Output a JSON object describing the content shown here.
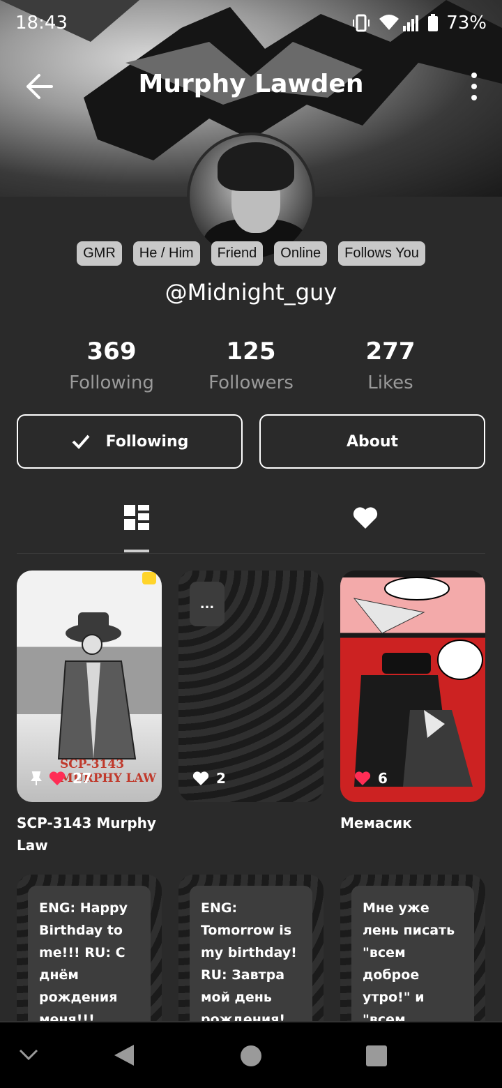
{
  "status_bar": {
    "time": "18:43",
    "battery": "73%"
  },
  "header": {
    "title": "Murphy Lawden",
    "back_icon": "arrow-left-icon",
    "more_icon": "more-vertical-icon"
  },
  "profile": {
    "tags": [
      "GMR",
      "He / Him",
      "Friend",
      "Online",
      "Follows You"
    ],
    "username": "@Midnight_guy",
    "stats": [
      {
        "value": "369",
        "label": "Following"
      },
      {
        "value": "125",
        "label": "Followers"
      },
      {
        "value": "277",
        "label": "Likes"
      }
    ],
    "buttons": {
      "following": "Following",
      "about": "About"
    }
  },
  "tabs": [
    {
      "icon": "grid-icon",
      "active": true
    },
    {
      "icon": "heart-icon",
      "active": false
    }
  ],
  "posts": [
    {
      "title": "SCP-3143 Murphy Law",
      "likes": "27",
      "pinned": true,
      "image_text": "SCP-3143 MURPHY LAW"
    },
    {
      "title": "",
      "likes": "2",
      "more_label": "..."
    },
    {
      "title": "Мемасик",
      "likes": "6"
    }
  ],
  "text_posts": [
    {
      "text": "ENG: Happy Birthday to me!!! RU: С днём рождения меня!!!"
    },
    {
      "text": "ENG: Tomorrow is my birthday! RU: Завтра мой день рождения!"
    },
    {
      "text": "Мне уже лень писать \"всем доброе утро!\" и \"всем"
    }
  ],
  "colors": {
    "background": "#2a2a2a",
    "heart": "#ff2d55",
    "tag_bg": "#c8c8c8"
  }
}
